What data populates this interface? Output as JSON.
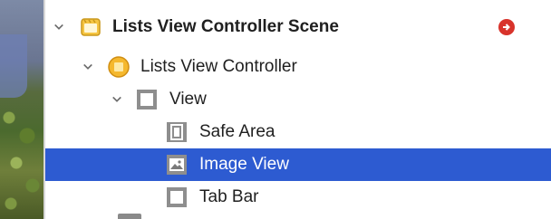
{
  "outline": {
    "scene": {
      "label": "Lists View Controller Scene",
      "icon": "scene-icon",
      "action_icon": "go-to-arrow-icon"
    },
    "controller": {
      "label": "Lists View Controller",
      "icon": "view-controller-icon"
    },
    "view": {
      "label": "View",
      "icon": "view-icon"
    },
    "children": [
      {
        "label": "Safe Area",
        "icon": "safe-area-icon"
      },
      {
        "label": "Image View",
        "icon": "image-view-icon",
        "selected": true
      },
      {
        "label": "Tab Bar",
        "icon": "view-icon"
      }
    ]
  },
  "colors": {
    "selection": "#2d5bd1",
    "scene_icon": "#f5c542",
    "action": "#d8332b"
  }
}
